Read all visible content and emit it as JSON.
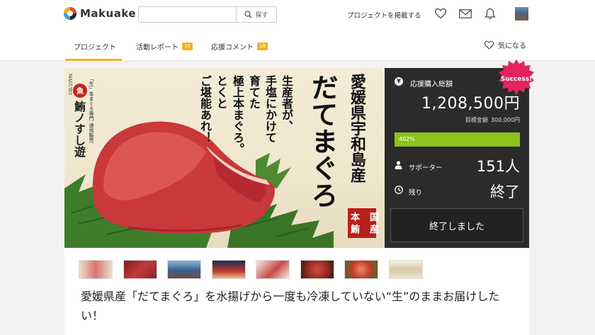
{
  "header": {
    "logo_text": "Makuake",
    "search_placeholder": "",
    "search_button": "探す",
    "post_project": "プロジェクトを掲載する",
    "icons": [
      "heart-icon",
      "mail-icon",
      "bell-icon"
    ]
  },
  "tabs": [
    {
      "label": "プロジェクト",
      "active": true
    },
    {
      "label": "活動レポート",
      "badge": "10"
    },
    {
      "label": "応援コメント",
      "badge": "18"
    }
  ],
  "favorite_label": "気になる",
  "hero": {
    "headline": "愛媛県宇和島産",
    "product": "だてまぐろ",
    "tagline": [
      "生産者が、",
      "手塩にかけて",
      "育てた",
      "極上本まぐろ。",
      "とくと",
      "ご堪能あれ！"
    ],
    "brand_tag": "「生」本まぐろ専門 通信販売",
    "brand_small": "MAGURO",
    "brand_name": "鮪ノすし遊",
    "stamp": "国産本鮪"
  },
  "panel": {
    "amount_label": "応援購入総額",
    "amount": "1,208,500円",
    "goal_label": "目標金額",
    "goal_value": "300,000円",
    "progress_text": "402%",
    "progress_percent": 402,
    "supporters_label": "サポーター",
    "supporters_value": "151人",
    "remaining_label": "残り",
    "remaining_value": "終了",
    "end_button": "終了しました",
    "success_badge": "Success!"
  },
  "thumbnails": 8,
  "project_title": "愛媛県産「だてまぐろ」を水揚げから一度も冷凍していない“生”のままお届けしたい！",
  "colors": {
    "accent": "#f2b31c",
    "progress": "#8dc21f",
    "panel": "#2b2b2b",
    "success": "#e5235f"
  }
}
